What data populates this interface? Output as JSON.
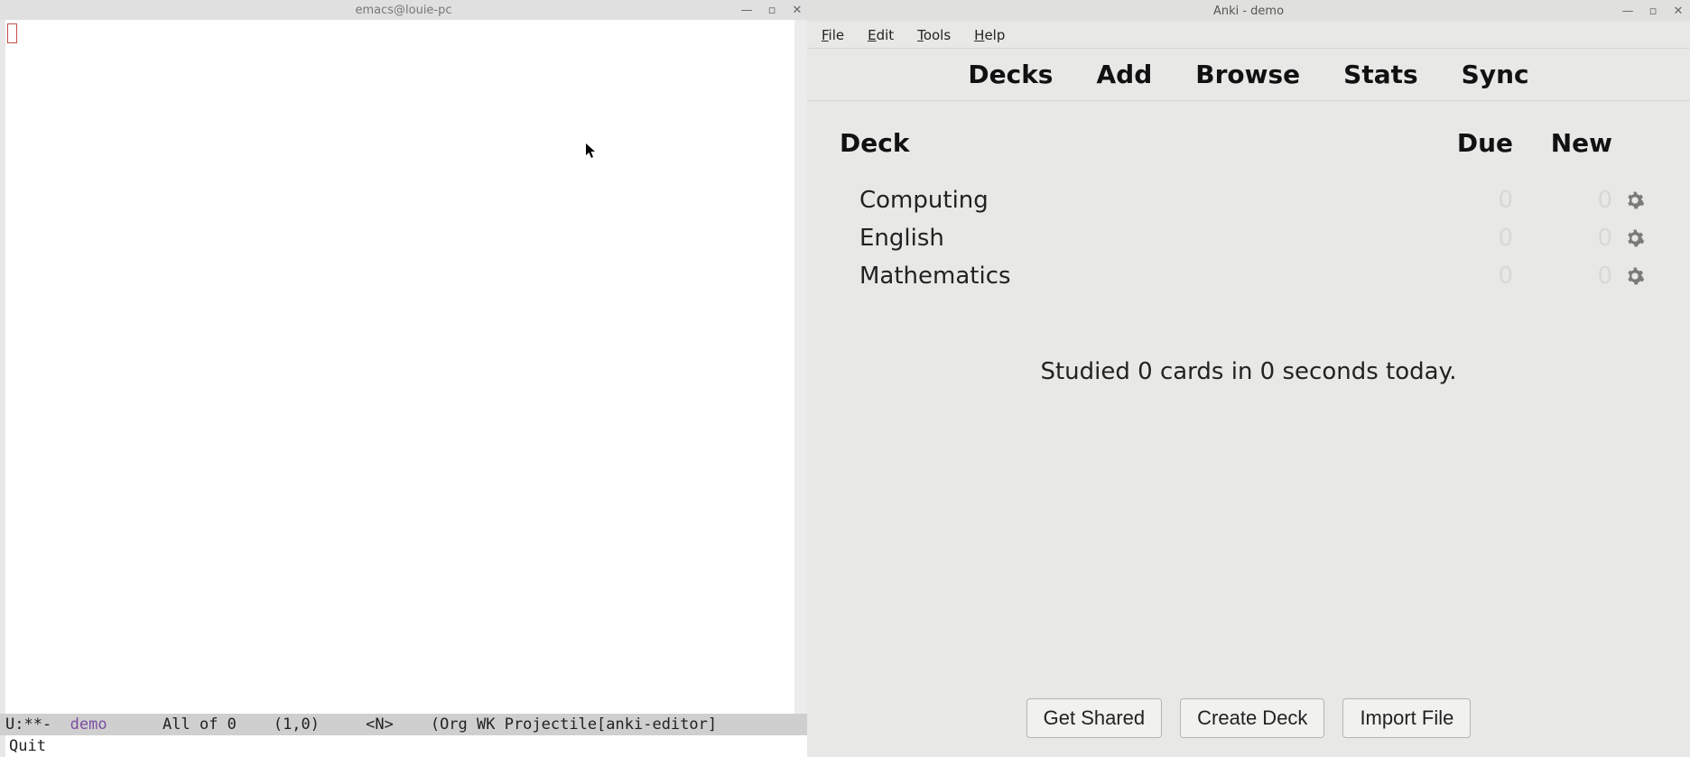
{
  "emacs": {
    "title": "emacs@louie-pc",
    "modeline": {
      "prefix": "U:**-  ",
      "buffer": "demo",
      "middle": "      All of 0    (1,0)     <N>    (Org WK Projectile[anki-editor]"
    },
    "minibuffer": "Quit",
    "window_controls": {
      "min": "—",
      "max": "▫",
      "close": "✕"
    }
  },
  "anki": {
    "title": "Anki - demo",
    "window_controls": {
      "min": "—",
      "max": "▫",
      "close": "✕"
    },
    "menubar": [
      "File",
      "Edit",
      "Tools",
      "Help"
    ],
    "toolbar": [
      "Decks",
      "Add",
      "Browse",
      "Stats",
      "Sync"
    ],
    "headers": {
      "deck": "Deck",
      "due": "Due",
      "new": "New"
    },
    "decks": [
      {
        "name": "Computing",
        "due": "0",
        "new": "0"
      },
      {
        "name": "English",
        "due": "0",
        "new": "0"
      },
      {
        "name": "Mathematics",
        "due": "0",
        "new": "0"
      }
    ],
    "studied": "Studied 0 cards in 0 seconds today.",
    "bottom": [
      "Get Shared",
      "Create Deck",
      "Import File"
    ]
  }
}
